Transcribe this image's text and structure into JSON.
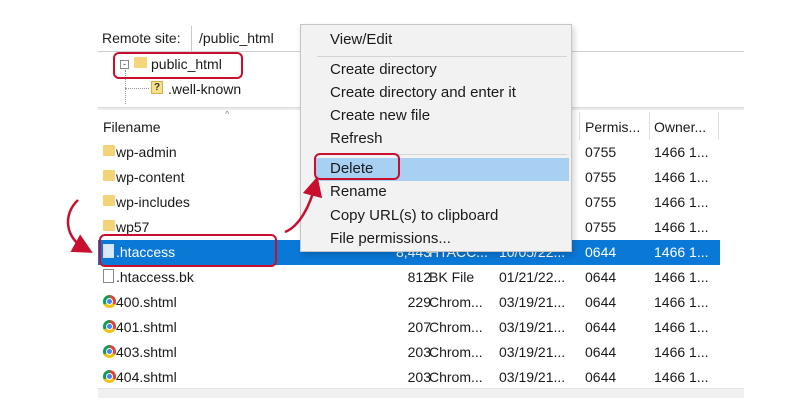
{
  "remote": {
    "label": "Remote site:",
    "path": "/public_html"
  },
  "tree": {
    "root": "public_html",
    "child": ".well-known",
    "expander": "-"
  },
  "header": {
    "filename": "Filename",
    "permissions": "Permis...",
    "owner": "Owner..."
  },
  "rows": [
    {
      "name": "wp-admin",
      "icon": "folder-icon",
      "size": "",
      "type": "",
      "modified": "",
      "perm": "0755",
      "owner": "1466 1...",
      "selected": false
    },
    {
      "name": "wp-content",
      "icon": "folder-icon",
      "size": "",
      "type": "",
      "modified": "",
      "perm": "0755",
      "owner": "1466 1...",
      "selected": false
    },
    {
      "name": "wp-includes",
      "icon": "folder-icon",
      "size": "",
      "type": "",
      "modified": "",
      "perm": "0755",
      "owner": "1466 1...",
      "selected": false
    },
    {
      "name": "wp57",
      "icon": "folder-icon",
      "size": "",
      "type": "",
      "modified": "",
      "perm": "0755",
      "owner": "1466 1...",
      "selected": false
    },
    {
      "name": ".htaccess",
      "icon": "file-icon",
      "size": "8,443",
      "type": "HTACC...",
      "modified": "10/05/22...",
      "perm": "0644",
      "owner": "1466 1...",
      "selected": true
    },
    {
      "name": ".htaccess.bk",
      "icon": "file-icon",
      "size": "812",
      "type": "BK File",
      "modified": "01/21/22...",
      "perm": "0644",
      "owner": "1466 1...",
      "selected": false
    },
    {
      "name": "400.shtml",
      "icon": "chrome-icon",
      "size": "229",
      "type": "Chrom...",
      "modified": "03/19/21...",
      "perm": "0644",
      "owner": "1466 1...",
      "selected": false
    },
    {
      "name": "401.shtml",
      "icon": "chrome-icon",
      "size": "207",
      "type": "Chrom...",
      "modified": "03/19/21...",
      "perm": "0644",
      "owner": "1466 1...",
      "selected": false
    },
    {
      "name": "403.shtml",
      "icon": "chrome-icon",
      "size": "203",
      "type": "Chrom...",
      "modified": "03/19/21...",
      "perm": "0644",
      "owner": "1466 1...",
      "selected": false
    },
    {
      "name": "404.shtml",
      "icon": "chrome-icon",
      "size": "203",
      "type": "Chrom...",
      "modified": "03/19/21...",
      "perm": "0644",
      "owner": "1466 1...",
      "selected": false
    }
  ],
  "context_menu": {
    "view_edit": "View/Edit",
    "create_directory": "Create directory",
    "create_directory_enter": "Create directory and enter it",
    "create_new_file": "Create new file",
    "refresh": "Refresh",
    "delete": "Delete",
    "rename": "Rename",
    "copy_url": "Copy URL(s) to clipboard",
    "file_permissions": "File permissions..."
  },
  "colors": {
    "selection": "#0a78d7",
    "menu_highlight": "#a7d0f3",
    "annotation": "#c8102e"
  }
}
